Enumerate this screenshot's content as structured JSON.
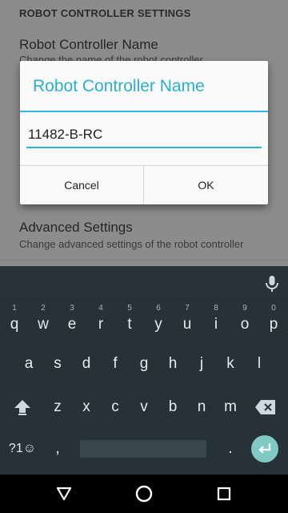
{
  "settings": {
    "section_header": "ROBOT CONTROLLER SETTINGS",
    "items": [
      {
        "title": "Robot Controller Name",
        "summary": "Change the name of the robot controller"
      },
      {
        "title": "Advanced Settings",
        "summary": "Change advanced settings of the robot controller"
      }
    ]
  },
  "dialog": {
    "title": "Robot Controller Name",
    "input_value": "11482-B-RC",
    "cancel_label": "Cancel",
    "ok_label": "OK",
    "accent_color": "#2ab0cf"
  },
  "keyboard": {
    "row1": [
      {
        "key": "q",
        "hint": "1"
      },
      {
        "key": "w",
        "hint": "2"
      },
      {
        "key": "e",
        "hint": "3"
      },
      {
        "key": "r",
        "hint": "4"
      },
      {
        "key": "t",
        "hint": "5"
      },
      {
        "key": "y",
        "hint": "6"
      },
      {
        "key": "u",
        "hint": "7"
      },
      {
        "key": "i",
        "hint": "8"
      },
      {
        "key": "o",
        "hint": "9"
      },
      {
        "key": "p",
        "hint": "0"
      }
    ],
    "row2": [
      "a",
      "s",
      "d",
      "f",
      "g",
      "h",
      "j",
      "k",
      "l"
    ],
    "row3": [
      "z",
      "x",
      "c",
      "v",
      "b",
      "n",
      "m"
    ],
    "symbols_key": "?1☺",
    "comma_key": ",",
    "period_key": ".",
    "icons": [
      "mic-icon",
      "shift-icon",
      "backspace-icon",
      "enter-icon"
    ]
  },
  "navbar": {
    "icons": [
      "back-icon",
      "home-icon",
      "recents-icon"
    ]
  }
}
